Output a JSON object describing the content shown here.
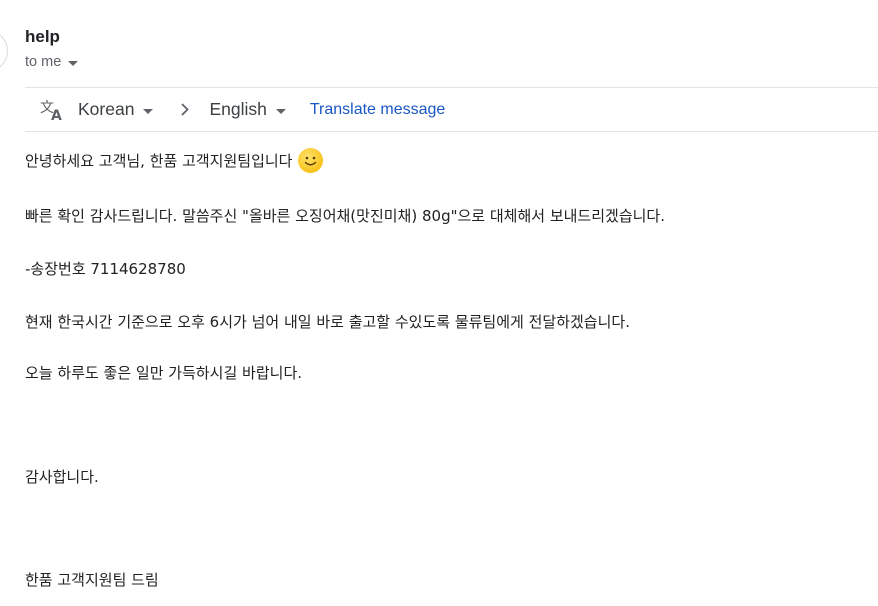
{
  "header": {
    "sender": "help",
    "recipient": "to me"
  },
  "translate_bar": {
    "icon": "translate-icon",
    "source_language": "Korean",
    "target_language": "English",
    "action_label": "Translate message"
  },
  "message": {
    "greeting": "안녕하세요 고객님, 한품 고객지원팀입니다",
    "greeting_emoji": "smiling-face-emoji",
    "line_confirm": "빠른 확인 감사드립니다. 말씀주신 \"올바른 오징어채(맛진미채) 80g\"으로 대체해서 보내드리겠습니다.",
    "line_invoice": "-송장번호 7114628780",
    "line_shipping": "현재 한국시간 기준으로 오후 6시가 넘어 내일 바로 출고할 수있도록 물류팀에게 전달하겠습니다.",
    "line_wish": "오늘 하루도 좋은 일만 가득하시길 바랍니다.",
    "line_thanks": "감사합니다.",
    "signature": "한품 고객지원팀 드림"
  },
  "colors": {
    "link": "#1a56c5",
    "muted": "#5f6368",
    "divider": "#e3e3e3"
  }
}
